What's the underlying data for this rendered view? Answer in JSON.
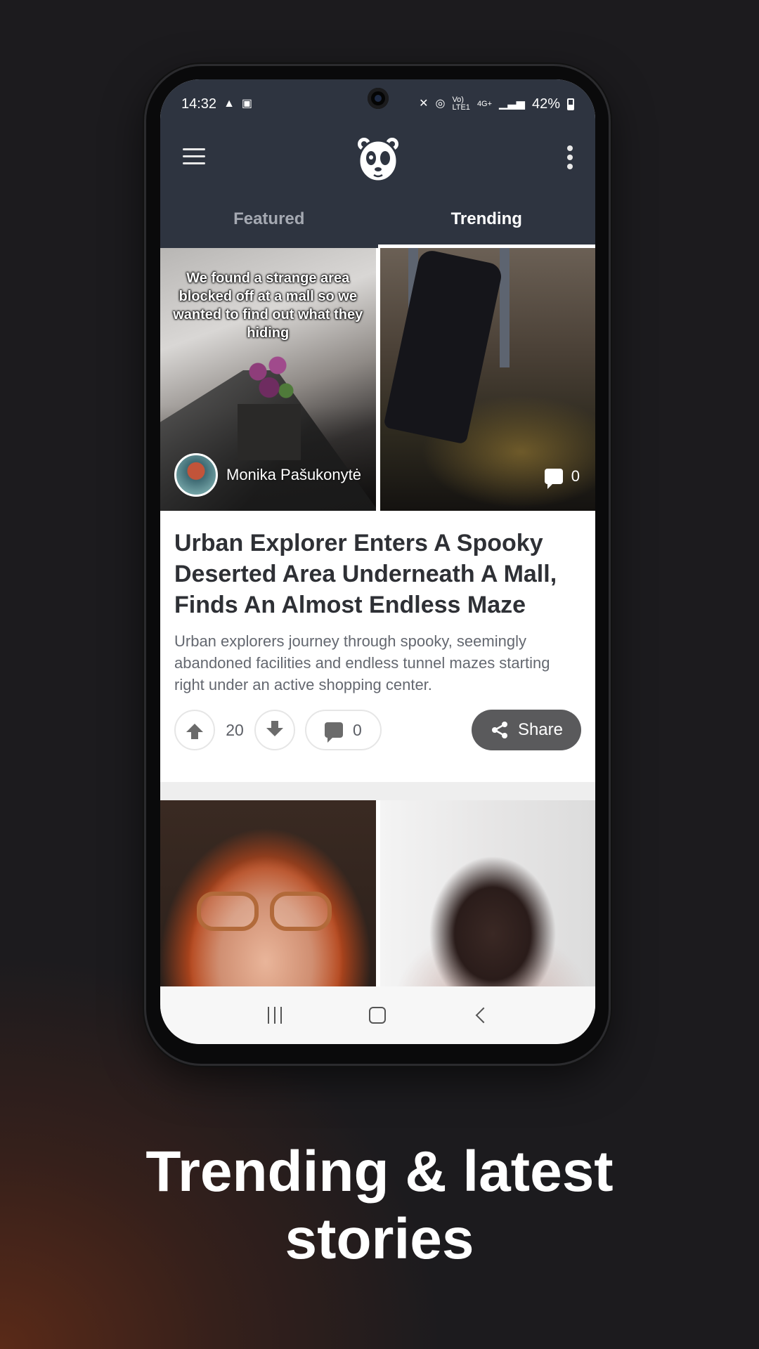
{
  "status_bar": {
    "time": "14:32",
    "battery": "42%",
    "network": "4G+"
  },
  "tabs": [
    {
      "label": "Featured",
      "active": false
    },
    {
      "label": "Trending",
      "active": true
    }
  ],
  "post": {
    "image_caption": "We found a strange area blocked off at a mall so we wanted to find out what they hiding",
    "author": "Monika Pašukonytė",
    "media_comments": "0",
    "title": "Urban Explorer Enters A Spooky Deserted Area Underneath A Mall, Finds An Almost Endless Maze",
    "description": "Urban explorers journey through spooky, seemingly abandoned facilities and endless tunnel mazes starting right under an active shopping center.",
    "votes": "20",
    "comments": "0",
    "share_label": "Share"
  },
  "caption": {
    "line1": "Trending & latest",
    "line2": "stories"
  },
  "colors": {
    "app_bar": "#2e3440",
    "share": "#5a5a5c",
    "background": "#1c1b1e",
    "accent_glow": "#5a2a18"
  },
  "icons": [
    "menu-icon",
    "panda-logo-icon",
    "more-vert-icon",
    "upvote-icon",
    "downvote-icon",
    "comment-icon",
    "share-icon"
  ]
}
